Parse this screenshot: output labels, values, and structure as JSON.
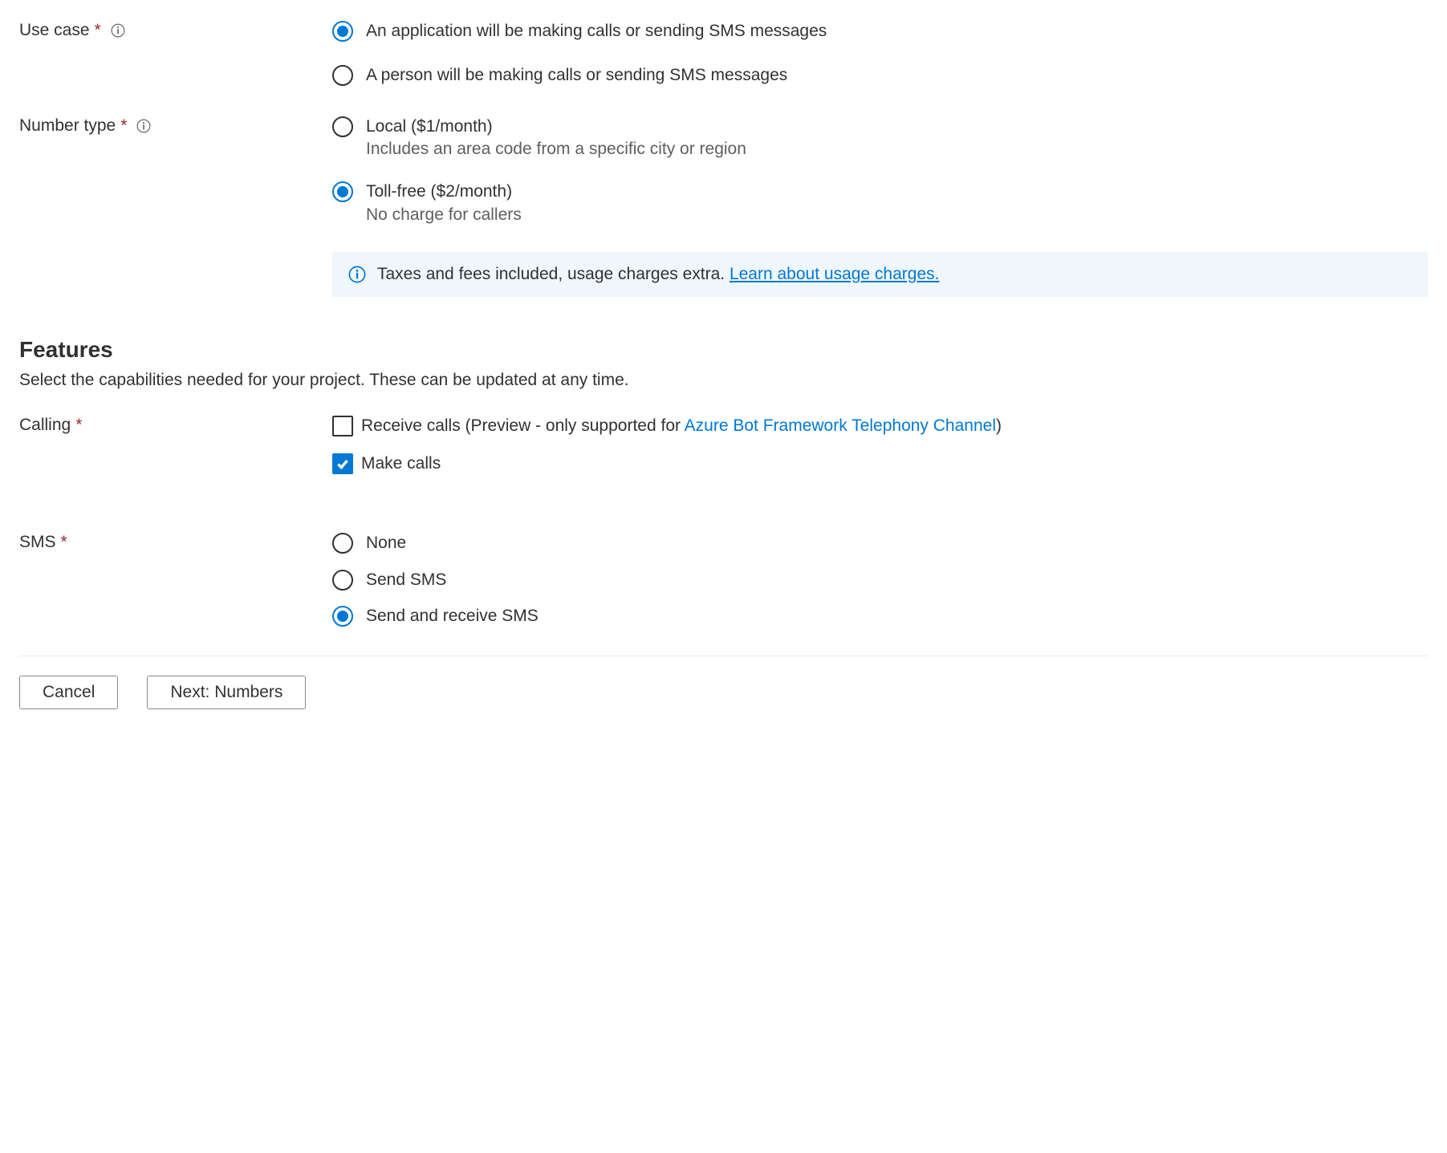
{
  "useCase": {
    "label": "Use case",
    "options": {
      "application": "An application will be making calls or sending SMS messages",
      "person": "A person will be making calls or sending SMS messages"
    }
  },
  "numberType": {
    "label": "Number type",
    "local": {
      "title": "Local ($1/month)",
      "sub": "Includes an area code from a specific city or region"
    },
    "tollFree": {
      "title": "Toll-free ($2/month)",
      "sub": "No charge for callers"
    },
    "infoText": "Taxes and fees included, usage charges extra. ",
    "infoLink": "Learn about usage charges."
  },
  "features": {
    "title": "Features",
    "desc": "Select the capabilities needed for your project. These can be updated at any time."
  },
  "calling": {
    "label": "Calling",
    "receivePrefix": "Receive calls (Preview - only supported for ",
    "receiveLink": "Azure Bot Framework Telephony Channel",
    "receiveSuffix": ")",
    "make": "Make calls"
  },
  "sms": {
    "label": "SMS",
    "none": "None",
    "send": "Send SMS",
    "sendReceive": "Send and receive SMS"
  },
  "buttons": {
    "cancel": "Cancel",
    "next": "Next: Numbers"
  }
}
